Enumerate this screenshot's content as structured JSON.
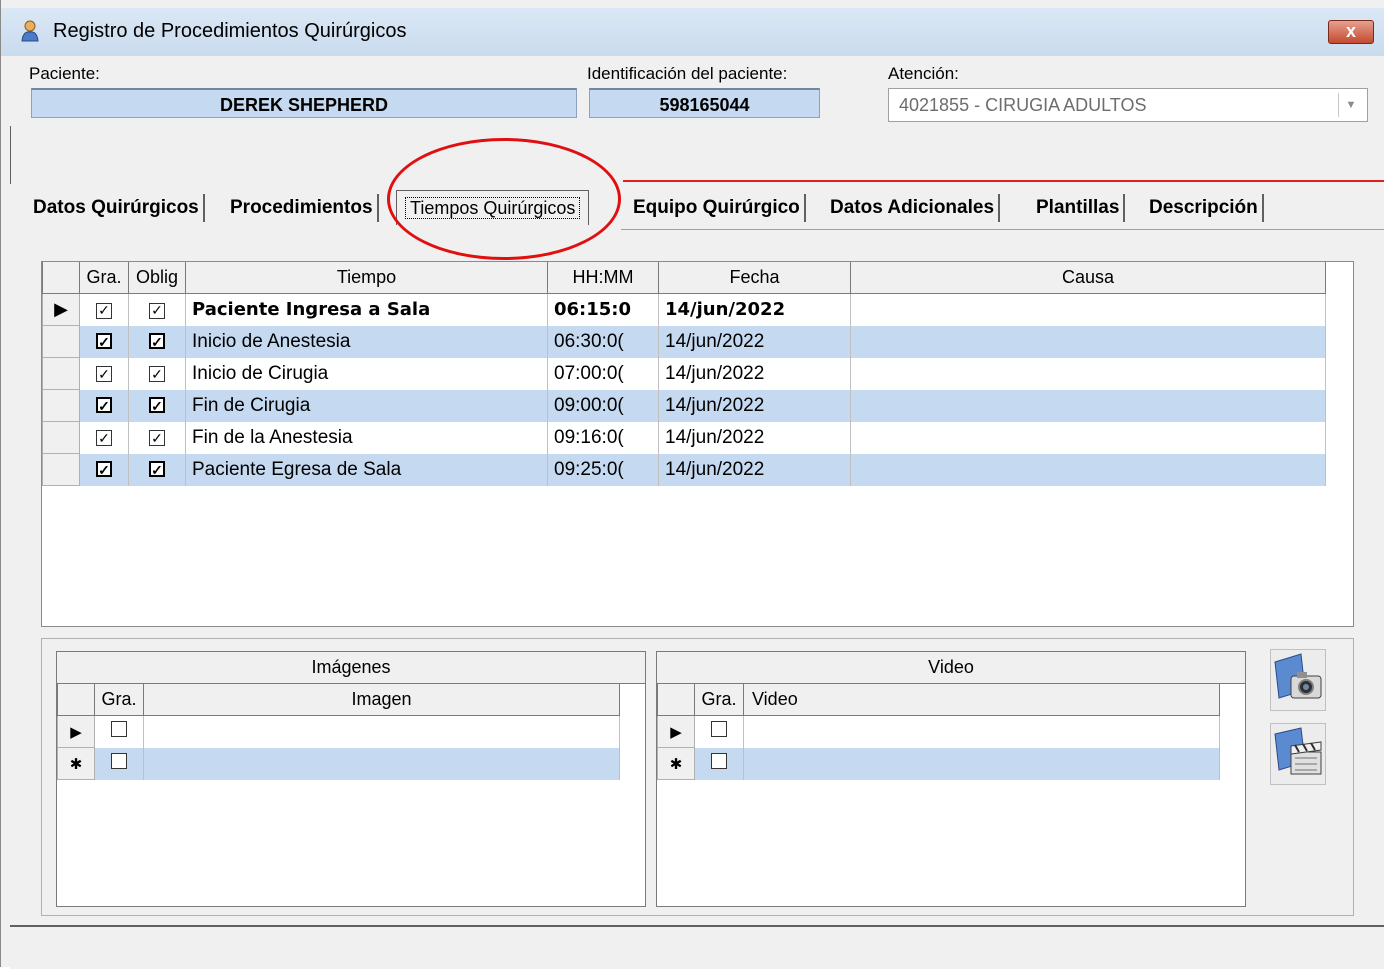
{
  "window": {
    "title": "Registro de Procedimientos Quirúrgicos",
    "close_label": "x"
  },
  "header": {
    "paciente_label": "Paciente:",
    "paciente_value": "DEREK SHEPHERD",
    "identificacion_label": "Identificación del paciente:",
    "identificacion_value": "598165044",
    "atencion_label": "Atención:",
    "atencion_value": "4021855 - CIRUGIA ADULTOS"
  },
  "tabs": [
    {
      "label": "Datos Quirúrgicos"
    },
    {
      "label": "Procedimientos"
    },
    {
      "label": "Tiempos Quirúrgicos"
    },
    {
      "label": "Equipo Quirúrgico"
    },
    {
      "label": "Datos Adicionales"
    },
    {
      "label": "Plantillas"
    },
    {
      "label": "Descripción"
    }
  ],
  "active_tab": "Tiempos Quirúrgicos",
  "annotation_color": "#e01010",
  "tiempos_table": {
    "columns": [
      "Gra.",
      "Oblig",
      "Tiempo",
      "HH:MM",
      "Fecha",
      "Causa"
    ],
    "rows": [
      {
        "gra": true,
        "oblig": true,
        "tiempo": "Paciente Ingresa a Sala",
        "hhmm": "06:15:0",
        "fecha": "14/jun/2022",
        "causa": ""
      },
      {
        "gra": true,
        "oblig": true,
        "tiempo": "Inicio de Anestesia",
        "hhmm": "06:30:0(",
        "fecha": "14/jun/2022",
        "causa": ""
      },
      {
        "gra": true,
        "oblig": true,
        "tiempo": "Inicio de Cirugia",
        "hhmm": "07:00:0(",
        "fecha": "14/jun/2022",
        "causa": ""
      },
      {
        "gra": true,
        "oblig": true,
        "tiempo": "Fin de Cirugia",
        "hhmm": "09:00:0(",
        "fecha": "14/jun/2022",
        "causa": ""
      },
      {
        "gra": true,
        "oblig": true,
        "tiempo": "Fin de la Anestesia",
        "hhmm": "09:16:0(",
        "fecha": "14/jun/2022",
        "causa": ""
      },
      {
        "gra": true,
        "oblig": true,
        "tiempo": "Paciente Egresa  de Sala",
        "hhmm": "09:25:0(",
        "fecha": "14/jun/2022",
        "causa": ""
      }
    ]
  },
  "imagenes": {
    "title": "Imágenes",
    "col_gra": "Gra.",
    "col_imagen": "Imagen"
  },
  "video": {
    "title": "Video",
    "col_gra": "Gra.",
    "col_video": "Video"
  },
  "row_markers": {
    "current": "▶",
    "new": "✱"
  },
  "icons": {
    "camera": "camera-icon",
    "clapper": "film-clapper-icon"
  },
  "colors": {
    "row_alt": "#c5d9f1",
    "field_bg": "#c5d9f1"
  }
}
